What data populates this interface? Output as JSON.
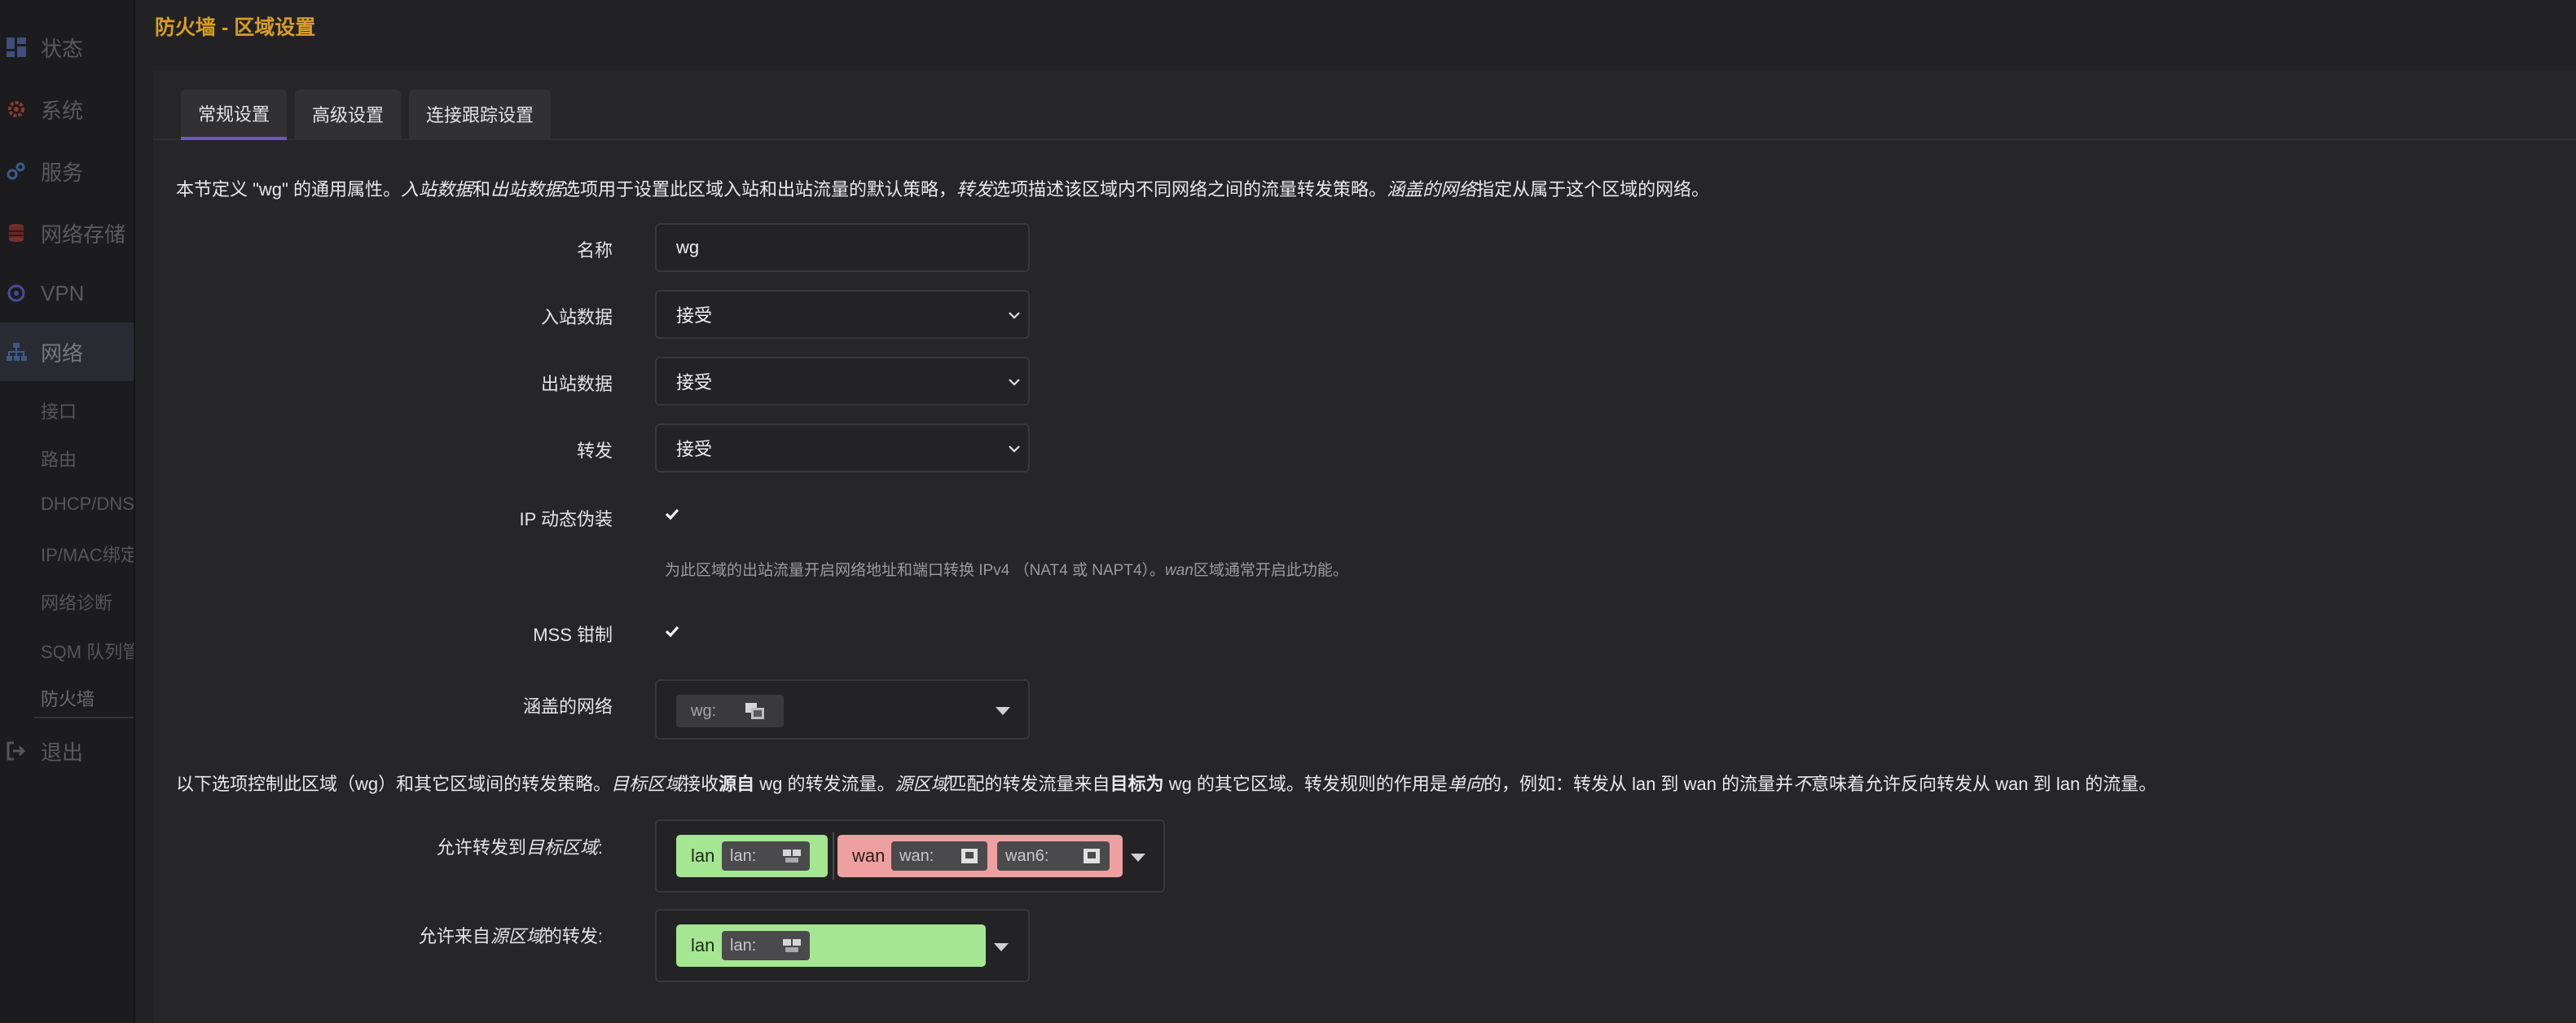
{
  "page": {
    "title": "防火墙 - 区域设置"
  },
  "sidebar": {
    "menu": [
      {
        "label": "状态",
        "icon": "dashboard-icon"
      },
      {
        "label": "系统",
        "icon": "gear-icon"
      },
      {
        "label": "服务",
        "icon": "services-icon"
      },
      {
        "label": "网络存储",
        "icon": "storage-icon"
      },
      {
        "label": "VPN",
        "icon": "vpn-icon"
      },
      {
        "label": "网络",
        "icon": "network-icon"
      }
    ],
    "submenu": [
      {
        "label": "接口"
      },
      {
        "label": "路由"
      },
      {
        "label": "DHCP/DNS"
      },
      {
        "label": "IP/MAC绑定"
      },
      {
        "label": "网络诊断"
      },
      {
        "label": "SQM 队列管理"
      },
      {
        "label": "防火墙"
      }
    ],
    "logout": {
      "label": "退出",
      "icon": "logout-icon"
    }
  },
  "tabs": [
    {
      "label": "常规设置",
      "active": true
    },
    {
      "label": "高级设置",
      "active": false
    },
    {
      "label": "连接跟踪设置",
      "active": false
    }
  ],
  "intro": {
    "p1": "本节定义 \"wg\" 的通用属性。",
    "p2": "入站数据",
    "p3": "和",
    "p4": "出站数据",
    "p5": "选项用于设置此区域入站和出站流量的默认策略，",
    "p6": "转发",
    "p7": "选项描述该区域内不同网络之间的流量转发策略。",
    "p8": "涵盖的网络",
    "p9": "指定从属于这个区域的网络。"
  },
  "form": {
    "name": {
      "label": "名称",
      "value": "wg"
    },
    "input": {
      "label": "入站数据",
      "value": "接受"
    },
    "output": {
      "label": "出站数据",
      "value": "接受"
    },
    "forward": {
      "label": "转发",
      "value": "接受"
    },
    "masq": {
      "label": "IP 动态伪装",
      "checked": true,
      "help_a": "为此区域的出站流量开启网络地址和端口转换 IPv4 （NAT4 或 NAPT4）。",
      "help_b": "wan",
      "help_c": "区域通常开启此功能。"
    },
    "mss": {
      "label": "MSS 钳制",
      "checked": true
    },
    "covered": {
      "label": "涵盖的网络",
      "chip": "wg:",
      "chip_icon": "interface-icon"
    }
  },
  "fwd_intro": {
    "p1": "以下选项控制此区域（wg）和其它区域间的转发策略。",
    "p2": "目标区域",
    "p3": "接收",
    "p4": "源自",
    "p5": " wg 的转发流量。",
    "p6": "源区域",
    "p7": "匹配的转发流量来自",
    "p8": "目标为",
    "p9": " wg 的其它区域。转发规则的作用是",
    "p10": "单向",
    "p11": "的，例如：转发从 lan 到 wan 的流量并",
    "p12": "不",
    "p13": "意味着允许反向转发从 wan 到 lan 的流量。"
  },
  "forwarding": {
    "dest": {
      "label_a": "允许转发到",
      "label_b": "目标区域",
      "label_c": ":",
      "zones": [
        {
          "name": "lan",
          "color": "#a5e692",
          "nets": [
            "lan:"
          ]
        },
        {
          "name": "wan",
          "color": "#eea0a0",
          "nets": [
            "wan:",
            "wan6:"
          ]
        }
      ]
    },
    "src": {
      "label_a": "允许来自",
      "label_b": "源区域",
      "label_c": "的转发:",
      "zones": [
        {
          "name": "lan",
          "color": "#a5e692",
          "nets": [
            "lan:"
          ]
        }
      ]
    }
  }
}
